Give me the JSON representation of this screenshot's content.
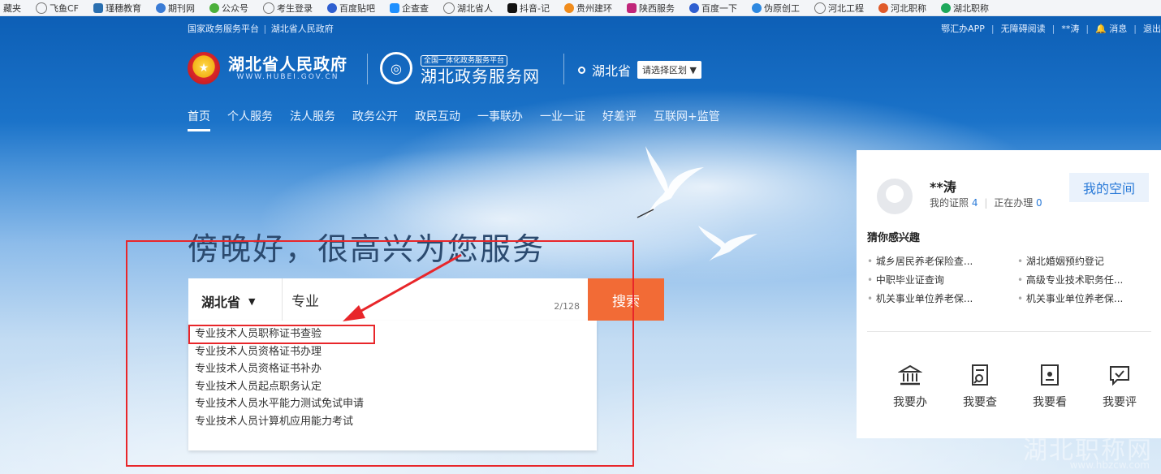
{
  "bookmarks": [
    "藏夹",
    "飞鱼CF",
    "瑾穗教育",
    "期刊网",
    "公众号",
    "考生登录",
    "百度贴吧",
    "企查查",
    "湖北省人",
    "抖音-记",
    "贵州建环",
    "陕西服务",
    "百度一下",
    "伪原创工",
    "河北工程",
    "河北职称",
    "湖北职称"
  ],
  "topbar": {
    "left": [
      "国家政务服务平台",
      "湖北省人民政府"
    ],
    "right": [
      "鄂汇办APP",
      "无障碍阅读",
      "**涛",
      "消息",
      "退出"
    ]
  },
  "logo1": {
    "title": "湖北省人民政府",
    "sub": "WWW.HUBEI.GOV.CN"
  },
  "logo2": {
    "badge": "全国一体化政务服务平台",
    "title": "湖北政务服务网"
  },
  "location": {
    "province": "湖北省",
    "select_label": "请选择区划"
  },
  "nav": [
    "首页",
    "个人服务",
    "法人服务",
    "政务公开",
    "政民互动",
    "一事联办",
    "一业一证",
    "好差评",
    "互联网+监管"
  ],
  "greeting": "傍晚好，很高兴为您服务",
  "search": {
    "scope": "湖北省",
    "value": "专业",
    "counter": "2/128",
    "button": "搜索"
  },
  "suggestions": [
    "专业技术人员职称证书查验",
    "专业技术人员资格证书办理",
    "专业技术人员资格证书补办",
    "专业技术人员起点职务认定",
    "专业技术人员水平能力测试免试申请",
    "专业技术人员计算机应用能力考试"
  ],
  "user": {
    "name": "**涛",
    "license_label": "我的证照",
    "license_count": "4",
    "processing_label": "正在办理",
    "processing_count": "0",
    "myspace": "我的空间"
  },
  "interest": {
    "title": "猜你感兴趣",
    "items": [
      "城乡居民养老保险查...",
      "湖北婚姻预约登记",
      "中职毕业证查询",
      "高级专业技术职务任...",
      "机关事业单位养老保...",
      "机关事业单位养老保..."
    ]
  },
  "actions": [
    "我要办",
    "我要查",
    "我要看",
    "我要评"
  ],
  "watermark": {
    "line1": "湖北职称网",
    "line2": "www.hbzcw.com"
  },
  "colors": {
    "nav_blue": "#0d5fb6",
    "search_button": "#f26b36",
    "highlight_red": "#e8262a",
    "link_blue": "#2b7bd8"
  }
}
